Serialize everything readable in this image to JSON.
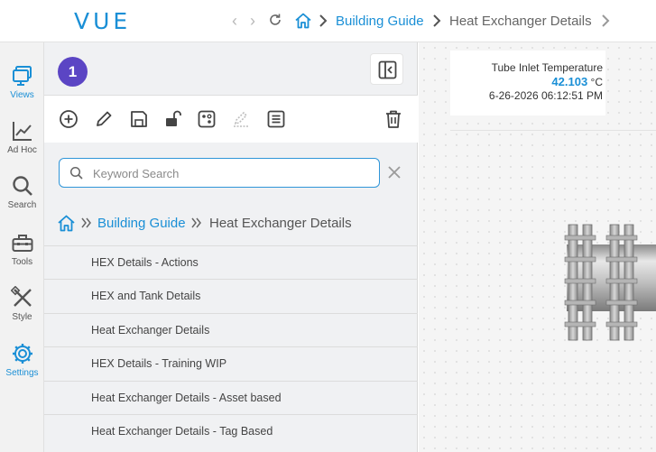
{
  "app": {
    "logo": "VUE"
  },
  "header": {
    "breadcrumb": {
      "link": "Building Guide",
      "current": "Heat Exchanger Details"
    }
  },
  "rail": {
    "items": [
      {
        "label": "Views",
        "icon": "views-icon",
        "active": true
      },
      {
        "label": "Ad Hoc",
        "icon": "chart-line-icon",
        "active": false
      },
      {
        "label": "Search",
        "icon": "search-icon",
        "active": false
      },
      {
        "label": "Tools",
        "icon": "toolbox-icon",
        "active": false
      },
      {
        "label": "Style",
        "icon": "brush-icon",
        "active": false
      },
      {
        "label": "Settings",
        "icon": "gear-icon",
        "active": true
      }
    ]
  },
  "panel": {
    "badge": "1",
    "search": {
      "placeholder": "Keyword Search",
      "value": ""
    },
    "breadcrumb": {
      "link": "Building Guide",
      "current": "Heat Exchanger Details"
    },
    "items": [
      "HEX Details - Actions",
      "HEX and Tank Details",
      "Heat Exchanger Details",
      "HEX Details - Training WIP",
      "Heat Exchanger Details - Asset based",
      "Heat Exchanger Details - Tag Based"
    ]
  },
  "canvas": {
    "card": {
      "label": "Tube Inlet Temperature",
      "value": "42.103",
      "unit": "°C",
      "timestamp": "6-26-2026 06:12:51 PM"
    }
  },
  "colors": {
    "accent": "#1a8fd6",
    "badge": "#5b45c4"
  }
}
